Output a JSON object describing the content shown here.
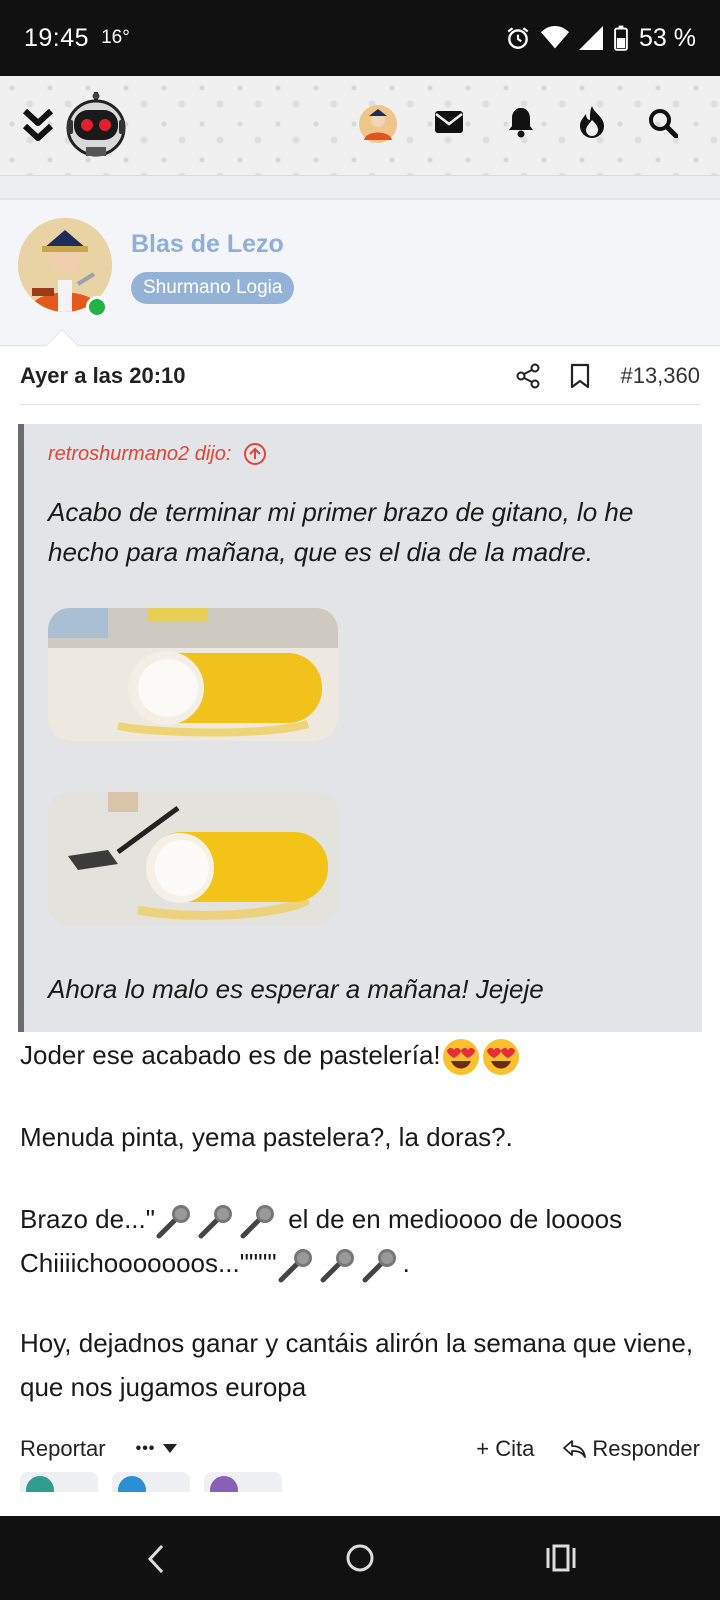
{
  "status_bar": {
    "time": "19:45",
    "temperature": "16°",
    "battery": "53 %"
  },
  "colors": {
    "accent": "#8eafd7",
    "badge": "#94b1d6",
    "quote_author": "#e0453a",
    "online": "#20b444"
  },
  "topbar": {
    "icons": [
      "chevrons-down-icon",
      "robot-logo",
      "user-avatar",
      "envelope-icon",
      "bell-icon",
      "fire-icon",
      "search-icon"
    ]
  },
  "author": {
    "name": "Blas de Lezo",
    "badge": "Shurmano Logia"
  },
  "post": {
    "date": "Ayer a las 20:10",
    "number": "#13,360",
    "quote": {
      "author": "retroshurmano2 dijo:",
      "text": "Acabo de terminar mi primer brazo de gitano, lo he hecho para mañana, que es el dia de la madre.",
      "tail": "Ahora lo malo es esperar a mañana! Jejeje"
    },
    "lines": {
      "l1": "Joder ese acabado es de pastelería!",
      "l2": "Menuda pinta, yema pastelera?, la doras?.",
      "l3a": "Brazo de...\"",
      "l3b": " el de en medioooo de loooos",
      "l4a": "Chiiiichooooooos...\"\"\"\"",
      "l4b": ".",
      "l5": "Hoy, dejadnos ganar y cantáis alirón la semana que viene, que nos jugamos europa"
    },
    "actions": {
      "report": "Reportar",
      "more": "•••",
      "quote": "+ Cita",
      "reply": "Responder"
    }
  }
}
